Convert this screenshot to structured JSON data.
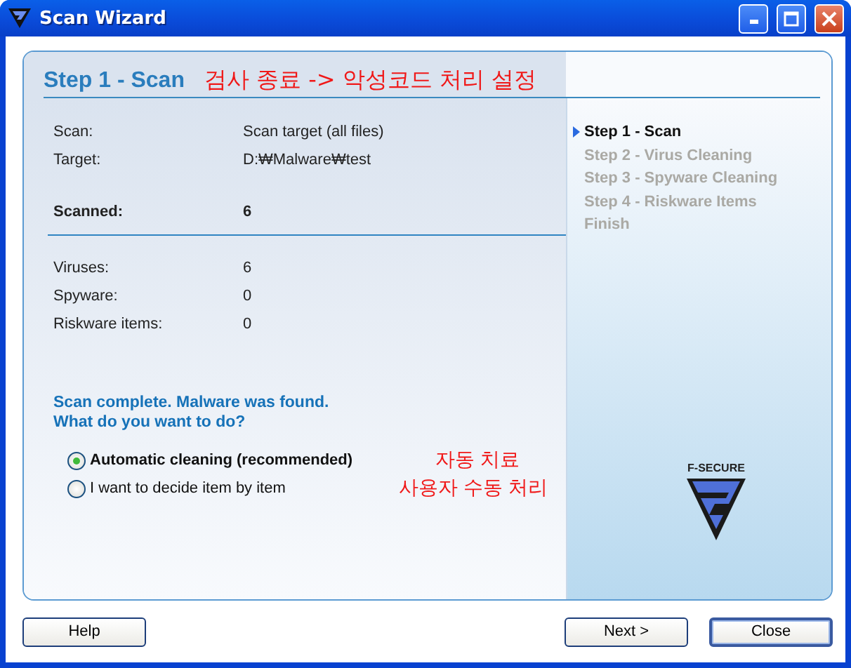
{
  "window": {
    "title": "Scan Wizard"
  },
  "header": {
    "title": "Step 1 - Scan",
    "annotation": "검사 종료 -> 악성코드 처리 설정"
  },
  "details": [
    {
      "label": "Scan:",
      "value": "Scan target (all files)"
    },
    {
      "label": "Target:",
      "value": "D:₩Malware₩test"
    }
  ],
  "scanned": {
    "label": "Scanned:",
    "value": "6"
  },
  "counts": [
    {
      "label": "Viruses:",
      "value": "6"
    },
    {
      "label": "Spyware:",
      "value": "0"
    },
    {
      "label": "Riskware items:",
      "value": "0"
    }
  ],
  "message": [
    "Scan complete. Malware was found.",
    "What do you want to do?"
  ],
  "options": [
    {
      "label": "Automatic cleaning (recommended)",
      "selected": true,
      "annotation": "자동 치료"
    },
    {
      "label": "I want to decide item by item",
      "selected": false,
      "annotation": "사용자 수동 처리"
    }
  ],
  "steps": [
    {
      "label": "Step 1 - Scan",
      "selected": true
    },
    {
      "label": "Step 2 - Virus Cleaning",
      "selected": false
    },
    {
      "label": "Step 3 - Spyware Cleaning",
      "selected": false
    },
    {
      "label": "Step 4 - Riskware Items",
      "selected": false
    },
    {
      "label": "Finish",
      "selected": false
    }
  ],
  "logo": {
    "text": "F-SECURE"
  },
  "buttons": [
    {
      "label": "Help",
      "default": false
    },
    {
      "label": "Next >",
      "default": false
    },
    {
      "label": "Close",
      "default": true
    }
  ]
}
